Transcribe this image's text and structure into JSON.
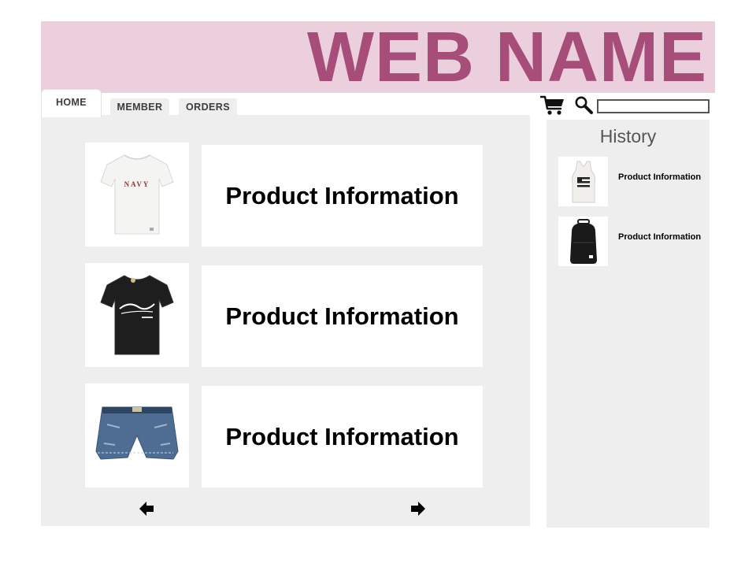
{
  "header": {
    "site_name": "WEB NAME"
  },
  "nav": {
    "tabs": [
      {
        "label": "HOME",
        "active": true
      },
      {
        "label": "MEMBER",
        "active": false
      },
      {
        "label": "ORDERS",
        "active": false
      }
    ]
  },
  "toolbar": {
    "cart_icon": "shopping-cart-icon",
    "search_icon": "magnifier-icon",
    "search": {
      "value": "",
      "placeholder": ""
    }
  },
  "products": [
    {
      "image": "white-tshirt-navy",
      "info": "Product Information"
    },
    {
      "image": "black-tshirt-script",
      "info": "Product Information"
    },
    {
      "image": "denim-shorts",
      "info": "Product Information"
    }
  ],
  "pagination": {
    "prev_icon": "arrow-left-icon",
    "next_icon": "arrow-right-icon"
  },
  "history": {
    "title": "History",
    "items": [
      {
        "image": "white-tank-top",
        "info": "Product Information"
      },
      {
        "image": "black-backpack",
        "info": "Product Information"
      }
    ]
  },
  "colors": {
    "banner_bg": "#ebcfdc",
    "brand": "#a64d7a",
    "panel_bg": "#eeeeee"
  }
}
